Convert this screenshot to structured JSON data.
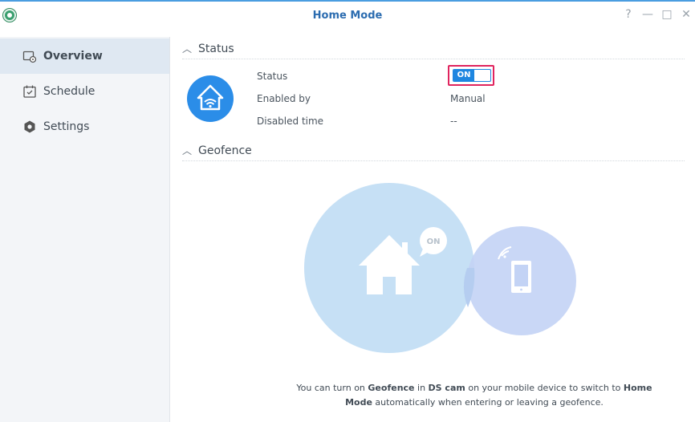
{
  "window": {
    "title": "Home Mode",
    "controls": {
      "help": "?",
      "minimize": "—",
      "maximize": "□",
      "close": "✕"
    },
    "accent": "#4a9de0"
  },
  "sidebar": {
    "items": [
      {
        "label": "Overview",
        "icon": "overview-icon",
        "active": true
      },
      {
        "label": "Schedule",
        "icon": "calendar-icon",
        "active": false
      },
      {
        "label": "Settings",
        "icon": "gear-icon",
        "active": false
      }
    ]
  },
  "status_section": {
    "header": "Status",
    "fields": [
      {
        "label": "Status",
        "value": "ON"
      },
      {
        "label": "Enabled by",
        "value": "Manual"
      },
      {
        "label": "Disabled time",
        "value": "--"
      }
    ],
    "toggle": {
      "label": "ON",
      "state": "on",
      "color": "#1e86e0",
      "highlight": "#e0245e"
    }
  },
  "geofence_section": {
    "header": "Geofence",
    "art_badge": "ON",
    "description": {
      "p1": "You can turn on ",
      "b1": "Geofence",
      "p2": " in ",
      "b2": "DS cam",
      "p3": " on your mobile device to switch to ",
      "b3": "Home",
      "b4": "Mode",
      "p4": " automatically when entering or leaving a geofence."
    }
  }
}
